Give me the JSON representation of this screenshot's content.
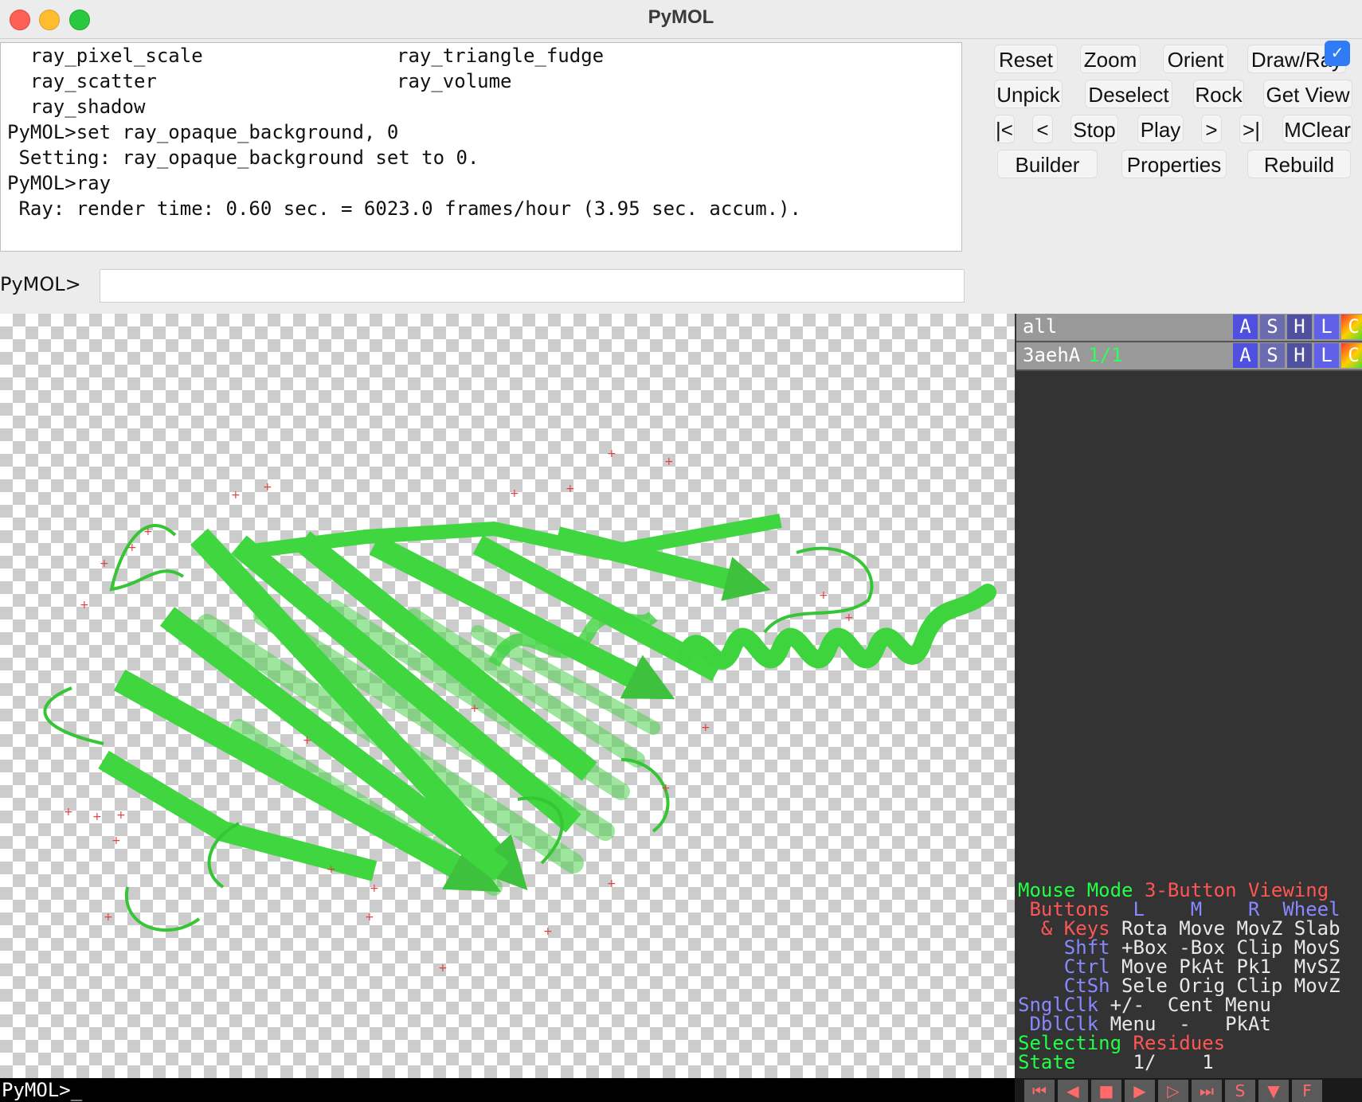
{
  "window": {
    "title": "PyMOL"
  },
  "log": {
    "lines": [
      {
        "col1": "  ray_pixel_scale",
        "col2": "ray_triangle_fudge"
      },
      {
        "col1": "  ray_scatter",
        "col2": "ray_volume"
      },
      {
        "col1": "  ray_shadow",
        "col2": ""
      },
      {
        "col1": "PyMOL>set ray_opaque_background, 0",
        "col2": ""
      },
      {
        "col1": " Setting: ray_opaque_background set to 0.",
        "col2": ""
      },
      {
        "col1": "PyMOL>ray",
        "col2": ""
      },
      {
        "col1": " Ray: render time: 0.60 sec. = 6023.0 frames/hour (3.95 sec. accum.).",
        "col2": ""
      }
    ]
  },
  "command": {
    "prompt": "PyMOL>",
    "value": ""
  },
  "buttons": {
    "row1": [
      "Reset",
      "Zoom",
      "Orient",
      "Draw/Ray"
    ],
    "row2": [
      "Unpick",
      "Deselect",
      "Rock",
      "Get View"
    ],
    "row3": [
      "|<",
      "<",
      "Stop",
      "Play",
      ">",
      ">|",
      "MClear"
    ],
    "row4": [
      "Builder",
      "Properties",
      "Rebuild"
    ]
  },
  "objects": [
    {
      "name": "all",
      "count": ""
    },
    {
      "name": "3aehA",
      "count": "1/1"
    }
  ],
  "object_buttons": [
    "A",
    "S",
    "H",
    "L",
    "C"
  ],
  "mouse_mode": {
    "l1a": "Mouse Mode ",
    "l1b": "3-Button Viewing",
    "l2a": " Buttons ",
    "l2b": " L    M    R  Wheel",
    "l3a": "  & Keys ",
    "l3b": "Rota Move MovZ Slab",
    "l4a": "    Shft ",
    "l4b": "+Box -Box Clip MovS",
    "l5a": "    Ctrl ",
    "l5b": "Move PkAt Pk1  MvSZ",
    "l6a": "    CtSh ",
    "l6b": "Sele Orig Clip MovZ",
    "l7a": "SnglClk ",
    "l7b": "+/-  Cent Menu",
    "l8a": " DblClk ",
    "l8b": "Menu  -   PkAt",
    "l9a": "Selecting ",
    "l9b": "Residues",
    "l10a": "State",
    "l10b": "     1/    1"
  },
  "bottom_prompt": "PyMOL>_",
  "movie_controls": [
    "⏮",
    "◀",
    "■",
    "▶",
    "▷",
    "⏭",
    "S",
    "▼",
    "F"
  ],
  "colors": {
    "ribbon": "#40d840",
    "panel_bg": "#333333",
    "highlight_green": "#22ff44",
    "label_red": "#ff5555",
    "label_blue": "#8888ff"
  }
}
